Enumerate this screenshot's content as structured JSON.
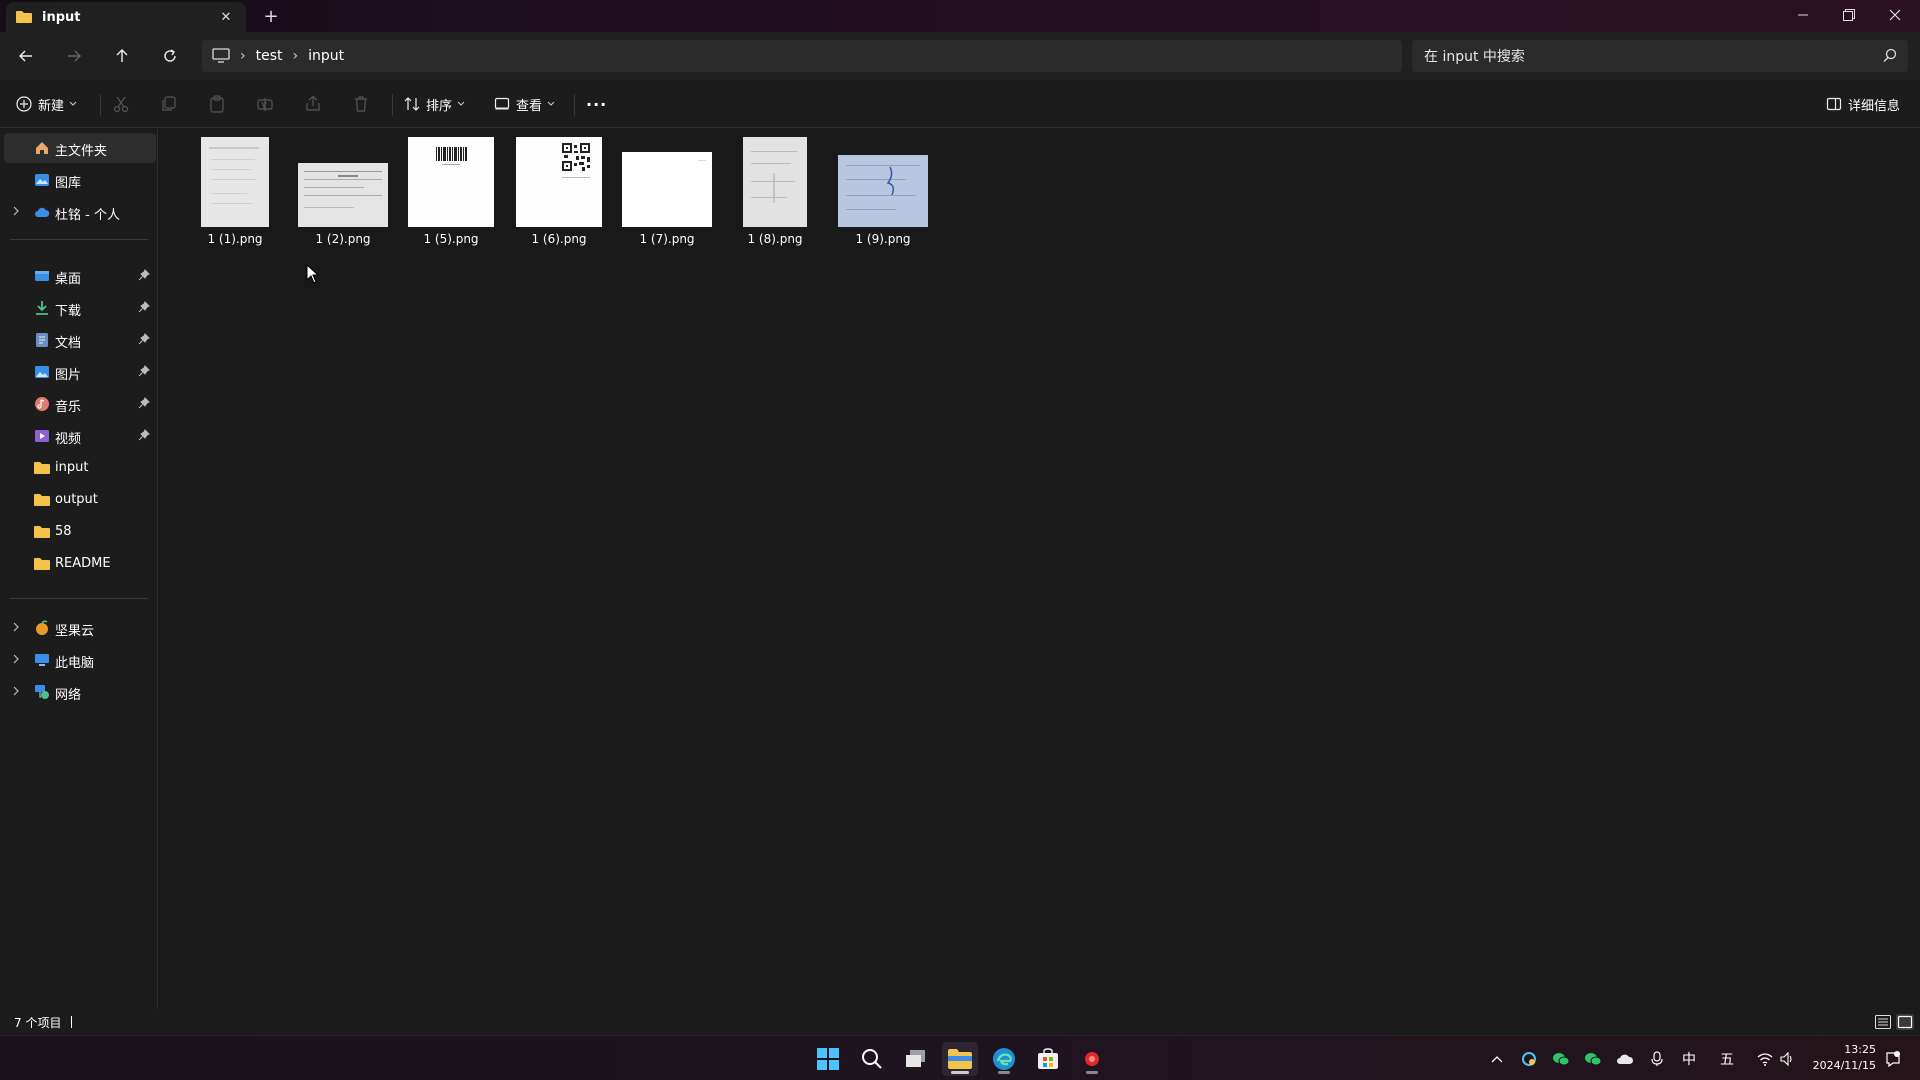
{
  "tab": {
    "title": "input",
    "close": "✕",
    "new_tab": "+"
  },
  "window_controls": {
    "minimize": "—",
    "maximize": "❐",
    "close": "✕"
  },
  "breadcrumb": [
    "test",
    "input"
  ],
  "search": {
    "placeholder": "在 input 中搜索"
  },
  "commands": {
    "new": "新建",
    "sort": "排序",
    "view": "查看",
    "more": "···",
    "details": "详细信息"
  },
  "sidebar": {
    "home": "主文件夹",
    "gallery": "图库",
    "onedrive": "杜铭 - 个人",
    "desktop": "桌面",
    "downloads": "下载",
    "documents": "文档",
    "pictures": "图片",
    "music": "音乐",
    "videos": "视频",
    "folder_input": "input",
    "folder_output": "output",
    "folder_58": "58",
    "folder_readme": "README",
    "jianguoyun": "坚果云",
    "this_pc": "此电脑",
    "network": "网络"
  },
  "files": [
    {
      "name": "1 (1).png",
      "preview": "document-photo"
    },
    {
      "name": "1 (2).png",
      "preview": "form-photo"
    },
    {
      "name": "1 (5).png",
      "preview": "barcode-document"
    },
    {
      "name": "1 (6).png",
      "preview": "qr-document"
    },
    {
      "name": "1 (7).png",
      "preview": "blank-document"
    },
    {
      "name": "1 (8).png",
      "preview": "document-photo"
    },
    {
      "name": "1 (9).png",
      "preview": "blue-form-photo"
    }
  ],
  "status": {
    "item_count": "7 个项目"
  },
  "taskbar": {
    "apps": [
      "windows-start",
      "search",
      "task-view",
      "file-explorer",
      "edge",
      "store",
      "recorder"
    ],
    "tray": {
      "ime_lang": "中",
      "ime_mode": "五"
    },
    "clock": {
      "time": "13:25",
      "date": "2024/11/15"
    }
  },
  "colors": {
    "accent": "#0078d4",
    "folder": "#f4c44a",
    "background": "#191919"
  }
}
